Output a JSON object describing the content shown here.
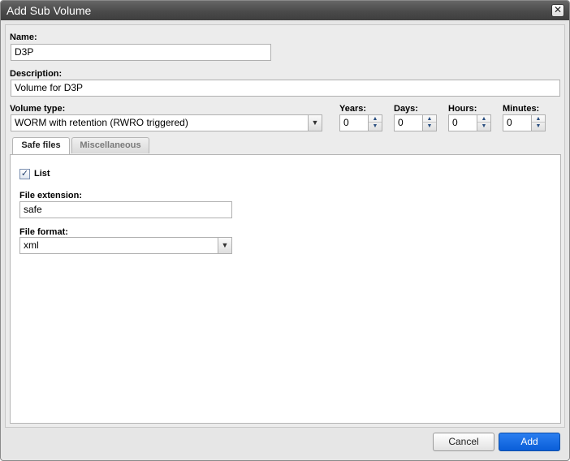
{
  "dialog": {
    "title": "Add Sub Volume",
    "close_symbol": "✕"
  },
  "fields": {
    "name_label": "Name:",
    "name_value": "D3P",
    "description_label": "Description:",
    "description_value": "Volume for D3P",
    "volume_type_label": "Volume type:",
    "volume_type_value": "WORM with retention (RWRO triggered)"
  },
  "retention": {
    "years_label": "Years:",
    "years_value": "0",
    "days_label": "Days:",
    "days_value": "0",
    "hours_label": "Hours:",
    "hours_value": "0",
    "minutes_label": "Minutes:",
    "minutes_value": "0"
  },
  "tabs": [
    {
      "label": "Safe files",
      "active": true
    },
    {
      "label": "Miscellaneous",
      "active": false
    }
  ],
  "safe_files": {
    "list_label": "List",
    "list_checked": true,
    "checkmark": "✓",
    "file_extension_label": "File extension:",
    "file_extension_value": "safe",
    "file_format_label": "File format:",
    "file_format_value": "xml"
  },
  "icons": {
    "dropdown": "chevron-down-icon",
    "spin_up": "triangle-up-icon",
    "spin_down": "triangle-down-icon",
    "close": "close-icon"
  },
  "glyphs": {
    "down": "▼",
    "up": "▲"
  },
  "footer": {
    "cancel_label": "Cancel",
    "add_label": "Add"
  },
  "colors": {
    "titlebar": "#4a4a4a",
    "primary_button": "#0a5ed8"
  }
}
